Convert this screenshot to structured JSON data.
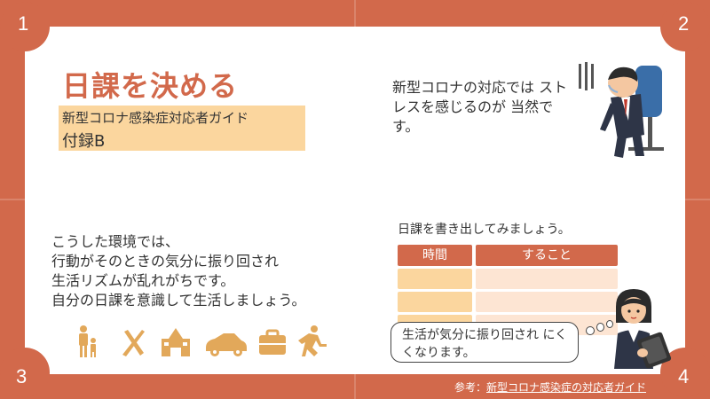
{
  "slide": {
    "title": "日課を決める",
    "subtitle_line1": "新型コロナ感染症対応者ガイド",
    "subtitle_line2": "付録B",
    "stress_text": "新型コロナの対応では ストレスを感じるのが 当然です。",
    "body_lines": [
      "こうした環境では、",
      "行動がそのときの気分に振り回され",
      "生活リズムが乱れがちです。",
      "自分の日課を意識して生活しましょう。"
    ],
    "table_lead": "日課を書き出してみましょう。",
    "table_headers": [
      "時間",
      "すること"
    ],
    "bubble_text": "生活が気分に振り回され にくくなります。",
    "reference_label": "参考：",
    "reference_link": "新型コロナ感染症の対応者ガイド",
    "corner_numbers": [
      "1",
      "2",
      "3",
      "4"
    ]
  },
  "icons": [
    "family-icon",
    "fork-knife-icon",
    "school-icon",
    "car-icon",
    "briefcase-icon",
    "running-icon"
  ],
  "colors": {
    "accent": "#d2694b",
    "highlight": "#fbd69e",
    "cell_light": "#fde5d3",
    "cell_dark": "#fbd69e",
    "icon": "#e2a85a"
  }
}
